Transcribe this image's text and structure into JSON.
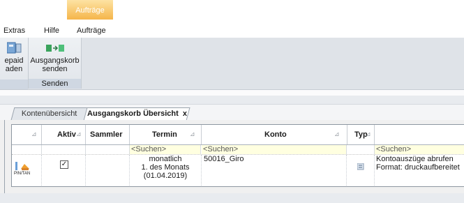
{
  "context_tab": {
    "label": "Aufträge",
    "color": "#f5b54a"
  },
  "menubar": {
    "items": [
      "Extras",
      "Hilfe",
      "Aufträge"
    ]
  },
  "ribbon": {
    "groups": [
      {
        "label": "",
        "buttons": [
          {
            "line1": "epaid",
            "line2": "aden",
            "icon": "prepaid-icon"
          }
        ]
      },
      {
        "label": "Senden",
        "buttons": [
          {
            "line1": "Ausgangskorb",
            "line2": "senden",
            "icon": "send-outbox-icon"
          }
        ]
      }
    ]
  },
  "doc_tabs": [
    {
      "label": "Kontenübersicht",
      "active": false
    },
    {
      "label": "Ausgangskorb Übersicht",
      "active": true,
      "close": "x"
    }
  ],
  "grid": {
    "columns": [
      "",
      "Aktiv",
      "Sammler",
      "Termin",
      "Konto",
      "Typ",
      ""
    ],
    "search_placeholder": "<Suchen>",
    "rows": [
      {
        "type_icon_label": "PIN/TAN",
        "aktiv": true,
        "sammler": "",
        "termin": [
          "monatlich",
          "1. des Monats",
          "(01.04.2019)"
        ],
        "konto": "50016_Giro",
        "typ_icon": "document-icon",
        "beschreibung": [
          "Kontoauszüge abrufen",
          "Format: druckaufbereitet"
        ]
      }
    ]
  }
}
